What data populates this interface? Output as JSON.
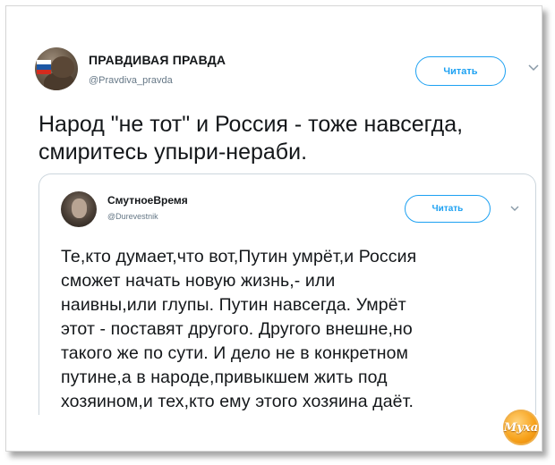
{
  "tweet": {
    "author_name": "ПРАВДИВАЯ ПРАВДА",
    "author_handle": "@Pravdiva_pravda",
    "follow_label": "Читать",
    "text_lines": [
      "Народ \"не тот\" и Россия - тоже навсегда,",
      "смиритесь упыри-нераби."
    ]
  },
  "quoted_tweet": {
    "author_name": "СмутноеВремя",
    "author_handle": "@Durevestnik",
    "follow_label": "Читать",
    "text_lines": [
      "Те,кто думает,что вот,Путин умрёт,и Россия",
      "сможет начать новую жизнь,- или",
      "наивны,или глупы. Путин навсегда. Умрёт",
      "этот - поставят другого. Другого внешне,но",
      "такого же по сути. И дело не в конкретном",
      "путине,а в народе,привыкшем жить под",
      "хозяином,и тех,кто ему этого хозяина даёт."
    ]
  },
  "watermark": {
    "text": "Муха"
  },
  "colors": {
    "accent": "#1da1f2",
    "text": "#14171a",
    "secondary_text": "#657786",
    "quote_border": "#ccd6dd",
    "badge": "#f7a21b"
  },
  "icons": {
    "chevron": "chevron-down-icon"
  }
}
